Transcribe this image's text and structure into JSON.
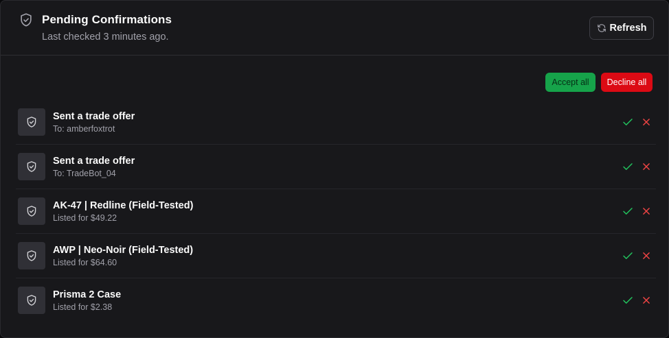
{
  "header": {
    "title": "Pending Confirmations",
    "subtitle": "Last checked 3 minutes ago.",
    "icon": "shield-check-icon",
    "refresh_label": "Refresh",
    "refresh_icon": "refresh-icon"
  },
  "actions": {
    "accept_all_label": "Accept all",
    "decline_all_label": "Decline all"
  },
  "confirmations": [
    {
      "title": "Sent a trade offer",
      "subtitle": "To: amberfoxtrot"
    },
    {
      "title": "Sent a trade offer",
      "subtitle": "To: TradeBot_04"
    },
    {
      "title": "AK-47 | Redline (Field-Tested)",
      "subtitle": "Listed for $49.22"
    },
    {
      "title": "AWP | Neo-Noir (Field-Tested)",
      "subtitle": "Listed for $64.60"
    },
    {
      "title": "Prisma 2 Case",
      "subtitle": "Listed for $2.38"
    }
  ],
  "colors": {
    "background": "#18181b",
    "accent_accept": "#16a34a",
    "accent_decline": "#dc0a14",
    "check_icon": "#22c55e",
    "x_icon": "#ef4444"
  }
}
